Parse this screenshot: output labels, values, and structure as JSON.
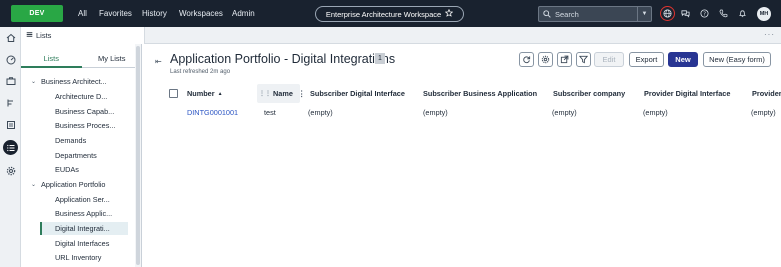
{
  "topbar": {
    "env_label": "DEV",
    "nav_items": [
      "All",
      "Favorites",
      "History",
      "Workspaces",
      "Admin"
    ],
    "workspace": "Enterprise Architecture Workspace",
    "search_placeholder": "Search",
    "avatar_initials": "MH"
  },
  "tabstrip": {
    "active_tab": "Lists",
    "more": "···"
  },
  "sidebar": {
    "subtabs": [
      "Lists",
      "My Lists"
    ],
    "active_subtab": "Lists",
    "tree": [
      {
        "label": "Business Architect...",
        "level": 0,
        "expanded": true
      },
      {
        "label": "Architecture D...",
        "level": 1
      },
      {
        "label": "Business Capab...",
        "level": 1
      },
      {
        "label": "Business Proces...",
        "level": 1
      },
      {
        "label": "Demands",
        "level": 1
      },
      {
        "label": "Departments",
        "level": 1
      },
      {
        "label": "EUDAs",
        "level": 1
      },
      {
        "label": "Application Portfolio",
        "level": 0,
        "expanded": true
      },
      {
        "label": "Application Ser...",
        "level": 1
      },
      {
        "label": "Business Applic...",
        "level": 1
      },
      {
        "label": "Digital Integrati...",
        "level": 1,
        "selected": true
      },
      {
        "label": "Digital Interfaces",
        "level": 1
      },
      {
        "label": "URL Inventory",
        "level": 1
      }
    ]
  },
  "main": {
    "title": "Application Portfolio - Digital Integrations",
    "count": "1",
    "refreshed": "Last refreshed 2m ago",
    "buttons": {
      "edit": "Edit",
      "export": "Export",
      "new": "New",
      "new_easy": "New (Easy form)"
    },
    "columns": [
      "Number",
      "Name",
      "Subscriber Digital Interface",
      "Subscriber Business Application",
      "Subscriber company",
      "Provider Digital Interface",
      "Provider"
    ],
    "sort_indicator": "▲",
    "rows": [
      [
        "DINTG0001001",
        "test",
        "(empty)",
        "(empty)",
        "(empty)",
        "(empty)",
        "(empty)"
      ]
    ]
  },
  "colors": {
    "topbar_bg": "#19222f",
    "env_green": "#29a745",
    "accent_green": "#2e7d5b",
    "primary_button": "#283593",
    "link": "#2b55c4",
    "globe_highlight": "#e0342f"
  }
}
